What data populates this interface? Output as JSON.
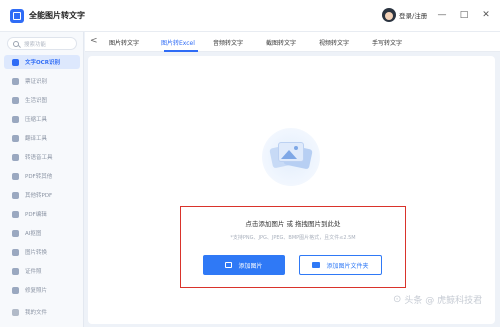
{
  "app": {
    "title": "全能图片转文字"
  },
  "user": {
    "login_label": "登录/注册"
  },
  "window_controls": {
    "minimize": "—",
    "maximize": "□",
    "close": "✕"
  },
  "search": {
    "placeholder": "搜索功能"
  },
  "sidebar": {
    "items": [
      {
        "label": "文字OCR识别",
        "icon": "ocr-icon"
      },
      {
        "label": "票证识别",
        "icon": "ticket-icon"
      },
      {
        "label": "生活识图",
        "icon": "leaf-icon"
      },
      {
        "label": "压缩工具",
        "icon": "compress-icon"
      },
      {
        "label": "翻译工具",
        "icon": "translate-icon"
      },
      {
        "label": "转语音工具",
        "icon": "speech-icon"
      },
      {
        "label": "PDF转其他",
        "icon": "pdf-icon"
      },
      {
        "label": "其他转PDF",
        "icon": "pdf-convert-icon"
      },
      {
        "label": "PDF编辑",
        "icon": "pdf-edit-icon"
      },
      {
        "label": "AI抠图",
        "icon": "ai-cutout-icon"
      },
      {
        "label": "图片转换",
        "icon": "image-convert-icon"
      },
      {
        "label": "证件照",
        "icon": "id-photo-icon"
      },
      {
        "label": "修复照片",
        "icon": "photo-repair-icon"
      }
    ],
    "my_files": "我的文件"
  },
  "tabs": {
    "back": "<",
    "items": [
      {
        "label": "图片转文字"
      },
      {
        "label": "图片转Excel"
      },
      {
        "label": "音频转文字"
      },
      {
        "label": "截图转文字"
      },
      {
        "label": "视频转文字"
      },
      {
        "label": "手写转文字"
      }
    ]
  },
  "upload": {
    "title": "点击添加图片 或 拖拽图片到此处",
    "hint": "*支持PNG、JPG、JPEG、BMP图片格式，且文件≤2.5M",
    "add_image_button": "添加图片",
    "add_folder_button": "添加图片文件夹"
  },
  "watermark": {
    "logo": "⊙",
    "text": "头条 @ 虎鲸科技君"
  },
  "colors": {
    "accent": "#2f6cf6",
    "highlight_border": "#d9332b"
  }
}
